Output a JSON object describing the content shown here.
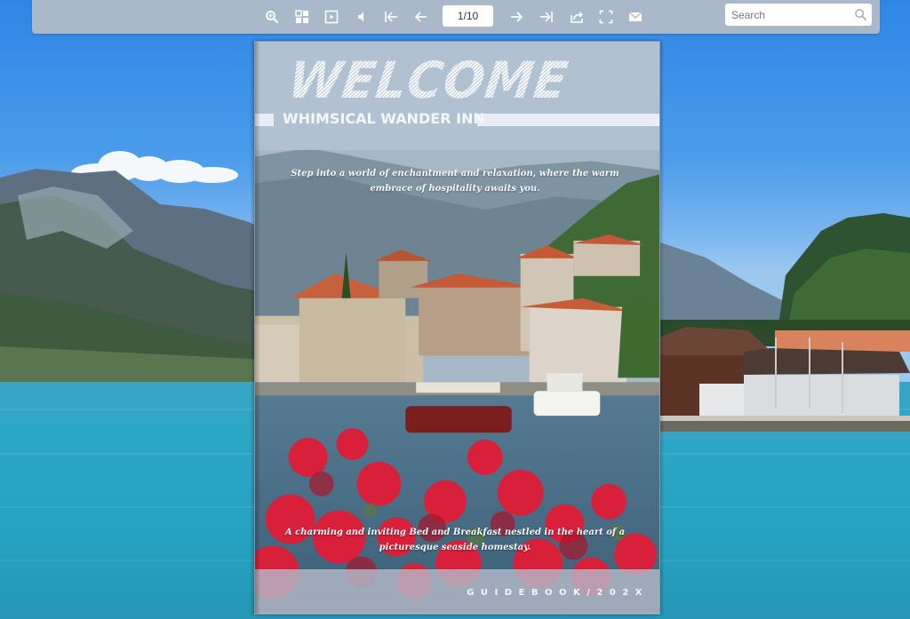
{
  "toolbar": {
    "buttons": [
      {
        "id": "zoom-in",
        "icon": "zoom-in-icon"
      },
      {
        "id": "thumbnails",
        "icon": "thumbnails-icon"
      },
      {
        "id": "autoplay",
        "icon": "play-icon"
      },
      {
        "id": "sound",
        "icon": "speaker-icon"
      },
      {
        "id": "first-page",
        "icon": "first-page-icon"
      },
      {
        "id": "previous-page",
        "icon": "arrow-left-icon"
      },
      {
        "id": "next-page",
        "icon": "arrow-right-icon"
      },
      {
        "id": "last-page",
        "icon": "last-page-icon"
      },
      {
        "id": "share",
        "icon": "share-icon"
      },
      {
        "id": "fullscreen",
        "icon": "fullscreen-icon"
      },
      {
        "id": "email",
        "icon": "mail-icon"
      }
    ],
    "page_indicator": "1/10",
    "search_placeholder": "Search"
  },
  "cover": {
    "welcome": "WELCOME",
    "inn_name": "WHIMSICAL WANDER INN",
    "tagline": "Step into a world of enchantment and relaxation, where the warm embrace of hospitality awaits you.",
    "description": "A charming and inviting Bed and Breakfast nestled in the heart of a picturesque seaside homestay.",
    "footer": "GUIDEBOOK/202X"
  },
  "colors": {
    "toolbar_bg": "#a9b9c9",
    "sky": "#2f86e6",
    "lake": "#27a3c2",
    "header_overlay": "#b2c4d4",
    "flower_red": "#d8203a"
  }
}
